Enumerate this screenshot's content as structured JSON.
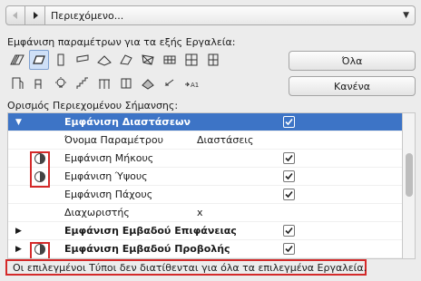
{
  "nav": {
    "back_label": "◀",
    "forward_label": "▶",
    "breadcrumb": "Περιεχόμενο..."
  },
  "tools_section": {
    "title": "Εμφάνιση παραμέτρων για τα εξής Εργαλεία:",
    "row1": [
      "wall-tool-icon",
      "slab-tool-icon",
      "column-tool-icon",
      "beam-tool-icon",
      "roof-tool-icon",
      "shell-tool-icon",
      "mesh-tool-icon",
      "morph-tool-icon",
      "curtainwall-tool-icon",
      "window-tool-icon"
    ],
    "row2": [
      "door-tool-icon",
      "object-tool-icon",
      "lamp-tool-icon",
      "stair-tool-icon",
      "railing-tool-icon",
      "zone-tool-icon",
      "skylight-tool-icon",
      "section-tool-icon",
      "label-tool-icon"
    ],
    "selected_tool": "slab-tool-icon"
  },
  "buttons": {
    "all": "Όλα",
    "none": "Κανένα"
  },
  "content_section": {
    "title": "Ορισμός Περιεχομένου Σήμανσης:"
  },
  "rows": [
    {
      "type": "header",
      "name": "Εμφάνιση Διαστάσεων",
      "checked": true,
      "indicator": false
    },
    {
      "type": "param",
      "name": "Όνομα Παραμέτρου",
      "value": "Διαστάσεις",
      "checked": null
    },
    {
      "type": "item",
      "name": "Εμφάνιση Μήκους",
      "checked": true,
      "indicator": true
    },
    {
      "type": "item",
      "name": "Εμφάνιση Ύψους",
      "checked": true,
      "indicator": true
    },
    {
      "type": "item",
      "name": "Εμφάνιση Πάχους",
      "checked": true,
      "indicator": false
    },
    {
      "type": "param",
      "name": "Διαχωριστής",
      "value": "x",
      "checked": null
    },
    {
      "type": "group",
      "name": "Εμφάνιση Εμβαδού Επιφάνειας",
      "checked": true,
      "indicator": false
    },
    {
      "type": "group",
      "name": "Εμφάνιση Εμβαδού Προβολής",
      "checked": true,
      "indicator": true
    }
  ],
  "message": "Οι επιλεγμένοι Τύποι δεν διατίθενται για όλα τα επιλεγμένα Εργαλεία.",
  "colors": {
    "selection": "#3d74c6",
    "highlight_box": "#d42a2a"
  }
}
